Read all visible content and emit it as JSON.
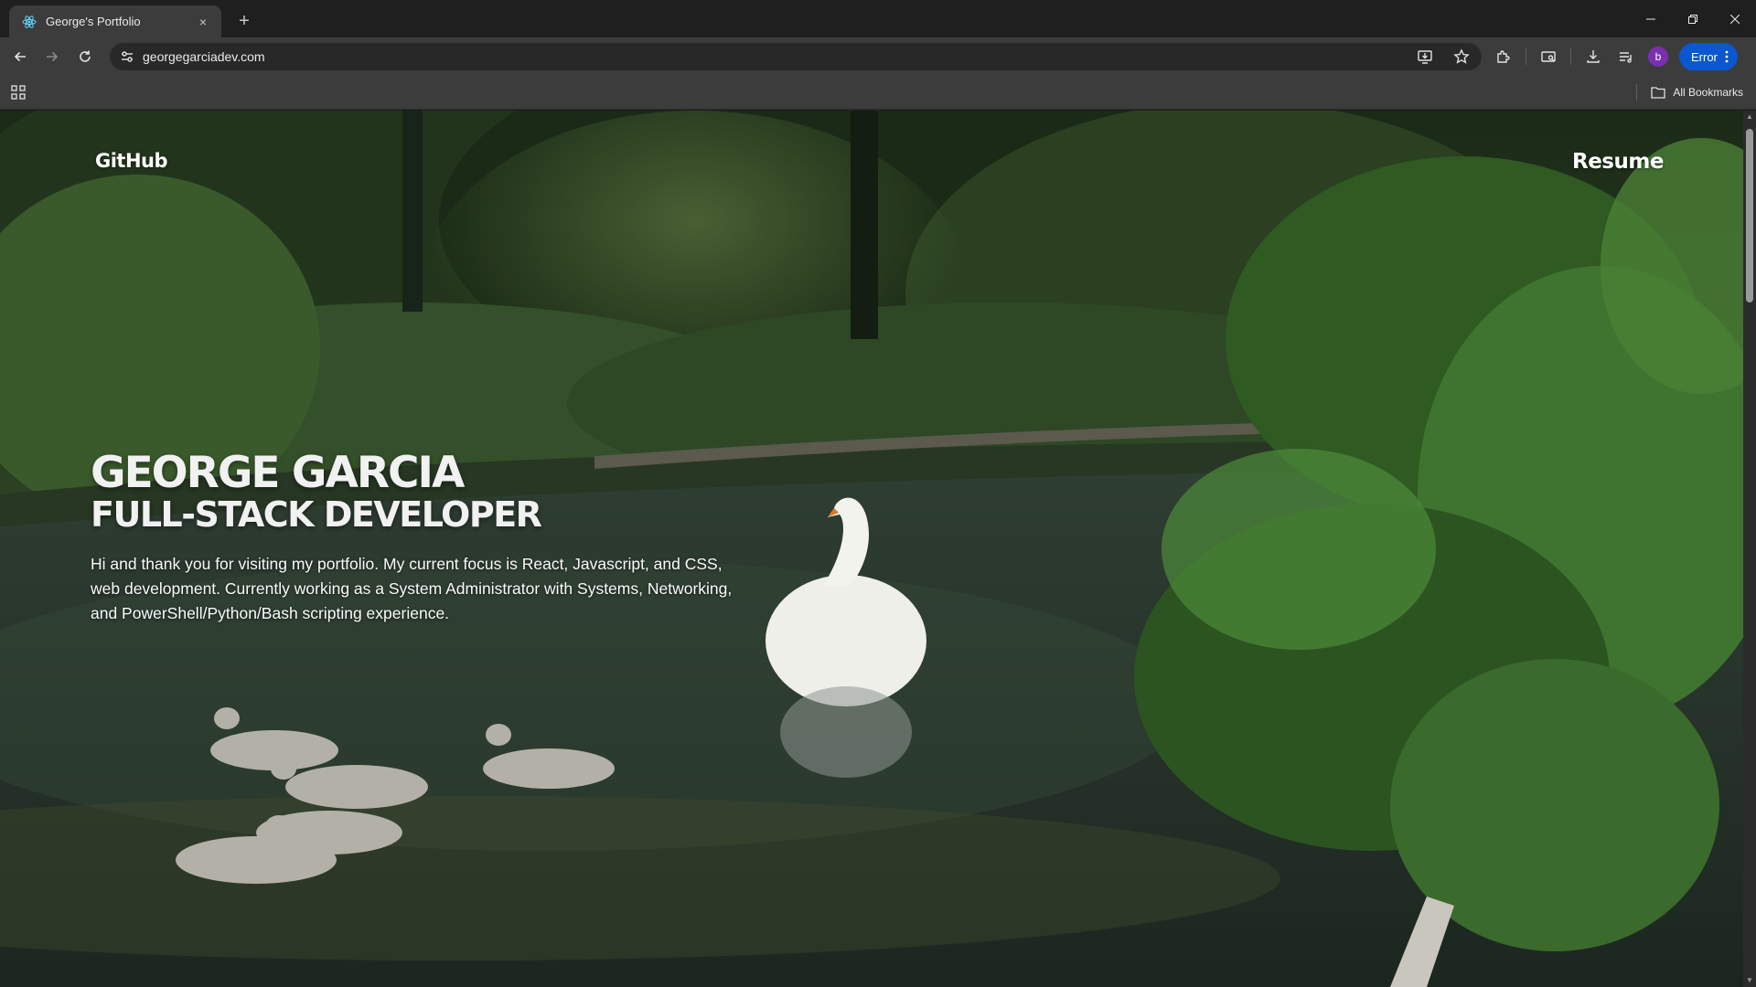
{
  "browser": {
    "tab": {
      "title": "George's Portfolio",
      "close_label": "×"
    },
    "new_tab_label": "+",
    "url": "georgegarciadev.com",
    "profile_initial": "b",
    "error_chip_label": "Error",
    "all_bookmarks_label": "All Bookmarks"
  },
  "page": {
    "nav": {
      "github_label": "GitHub",
      "resume_label": "Resume"
    },
    "hero": {
      "name": "GEORGE GARCIA",
      "role": "FULL-STACK DEVELOPER",
      "bio": "Hi and thank you for visiting my portfolio. My current focus is React, Javascript, and CSS, web development. Currently working as a System Administrator with Systems, Networking, and PowerShell/Python/Bash scripting experience."
    },
    "background": {
      "subject": "swan-and-cygnets-on-forest-pond"
    }
  },
  "colors": {
    "chrome_dark": "#1f1f1f",
    "chrome_bar": "#3c3c3c",
    "error_chip": "#0b57d0",
    "profile": "#7a2fb0"
  }
}
